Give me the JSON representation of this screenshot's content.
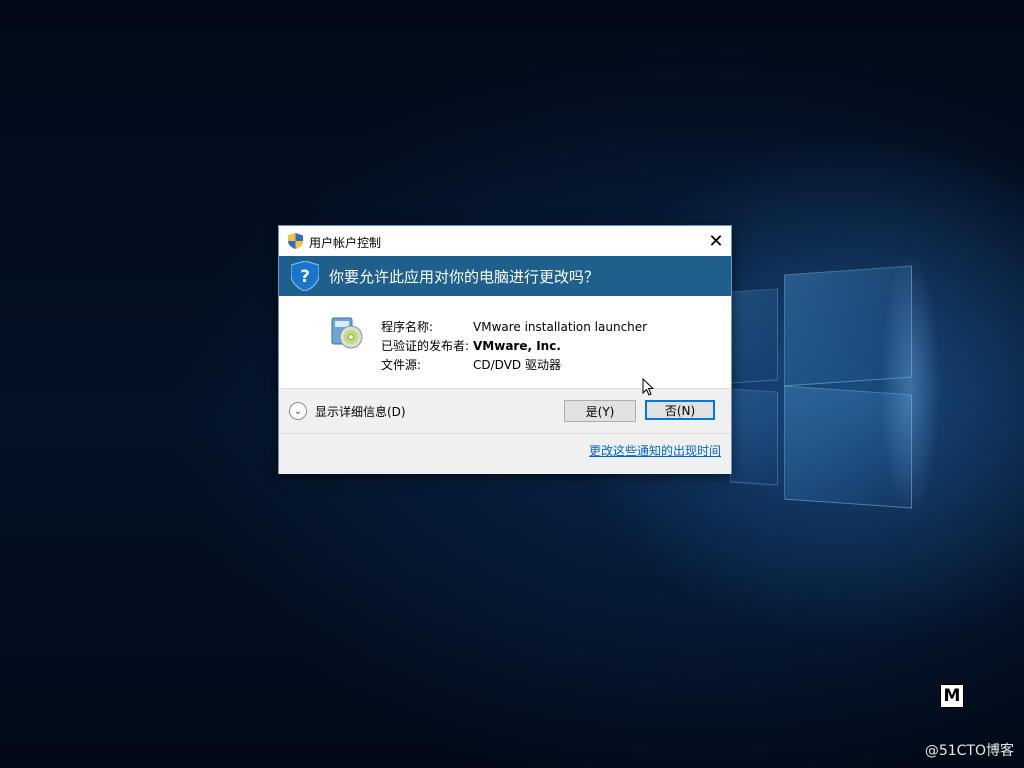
{
  "dialog": {
    "title": "用户帐户控制",
    "question": "你要允许此应用对你的电脑进行更改吗？",
    "fields": [
      {
        "label": "程序名称:",
        "value": "VMware installation launcher"
      },
      {
        "label": "已验证的发布者:",
        "value": "VMware, Inc."
      },
      {
        "label": "文件源:",
        "value": "CD/DVD 驱动器"
      }
    ],
    "details_label": "显示详细信息(D)",
    "yes_label": "是(Y)",
    "no_label": "否(N)",
    "change_link": "更改这些通知的出现时间",
    "close_glyph": "✕"
  },
  "desktop": {
    "badge": "M",
    "watermark": "@51CTO博客"
  },
  "colors": {
    "banner": "#1f5f8c",
    "focus_border": "#0078d7",
    "link": "#0066cc"
  },
  "icons": [
    "uac-shield-icon",
    "question-shield-icon",
    "installer-disc-icon",
    "chevron-down-icon",
    "close-icon",
    "mouse-cursor-icon"
  ]
}
